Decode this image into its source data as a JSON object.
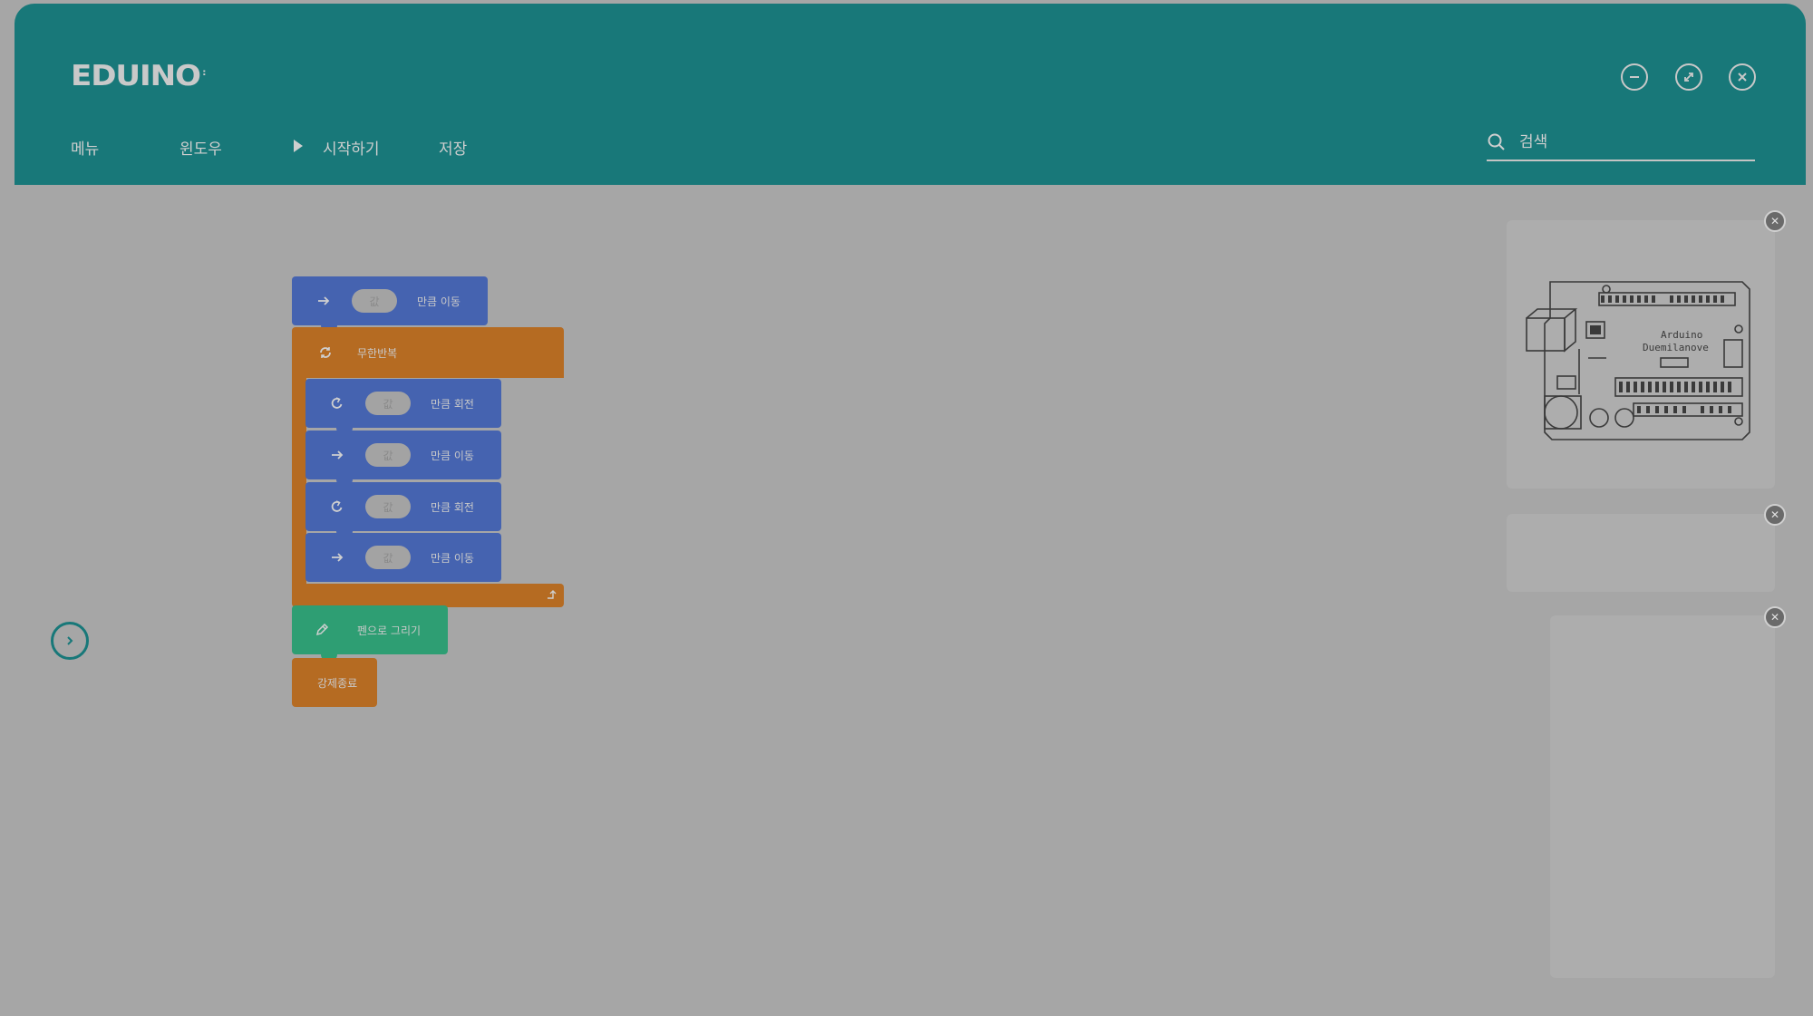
{
  "app": {
    "logo": "EDUINO",
    "logo_mark": ":"
  },
  "nav": {
    "menu": "메뉴",
    "window": "윈도우",
    "start": "시작하기",
    "save": "저장"
  },
  "search": {
    "placeholder": "검색"
  },
  "window_controls": {
    "minimize": "minimize-icon",
    "maximize": "expand-icon",
    "close": "close-icon"
  },
  "blocks": {
    "move1": {
      "value": "값",
      "label": "만큼 이동"
    },
    "loop": {
      "label": "무한반복"
    },
    "rotate1": {
      "value": "값",
      "label": "만큼 회전"
    },
    "move2": {
      "value": "값",
      "label": "만큼 이동"
    },
    "rotate2": {
      "value": "값",
      "label": "만큼 회전"
    },
    "move3": {
      "value": "값",
      "label": "만큼 이동"
    },
    "pen": {
      "label": "펜으로 그리기"
    },
    "stop": {
      "label": "강제종료"
    }
  },
  "colors": {
    "header": "#187879",
    "motion_block": "#4563b0",
    "control_block": "#b56b22",
    "pen_block": "#2e9e73",
    "background": "#a6a6a6"
  }
}
